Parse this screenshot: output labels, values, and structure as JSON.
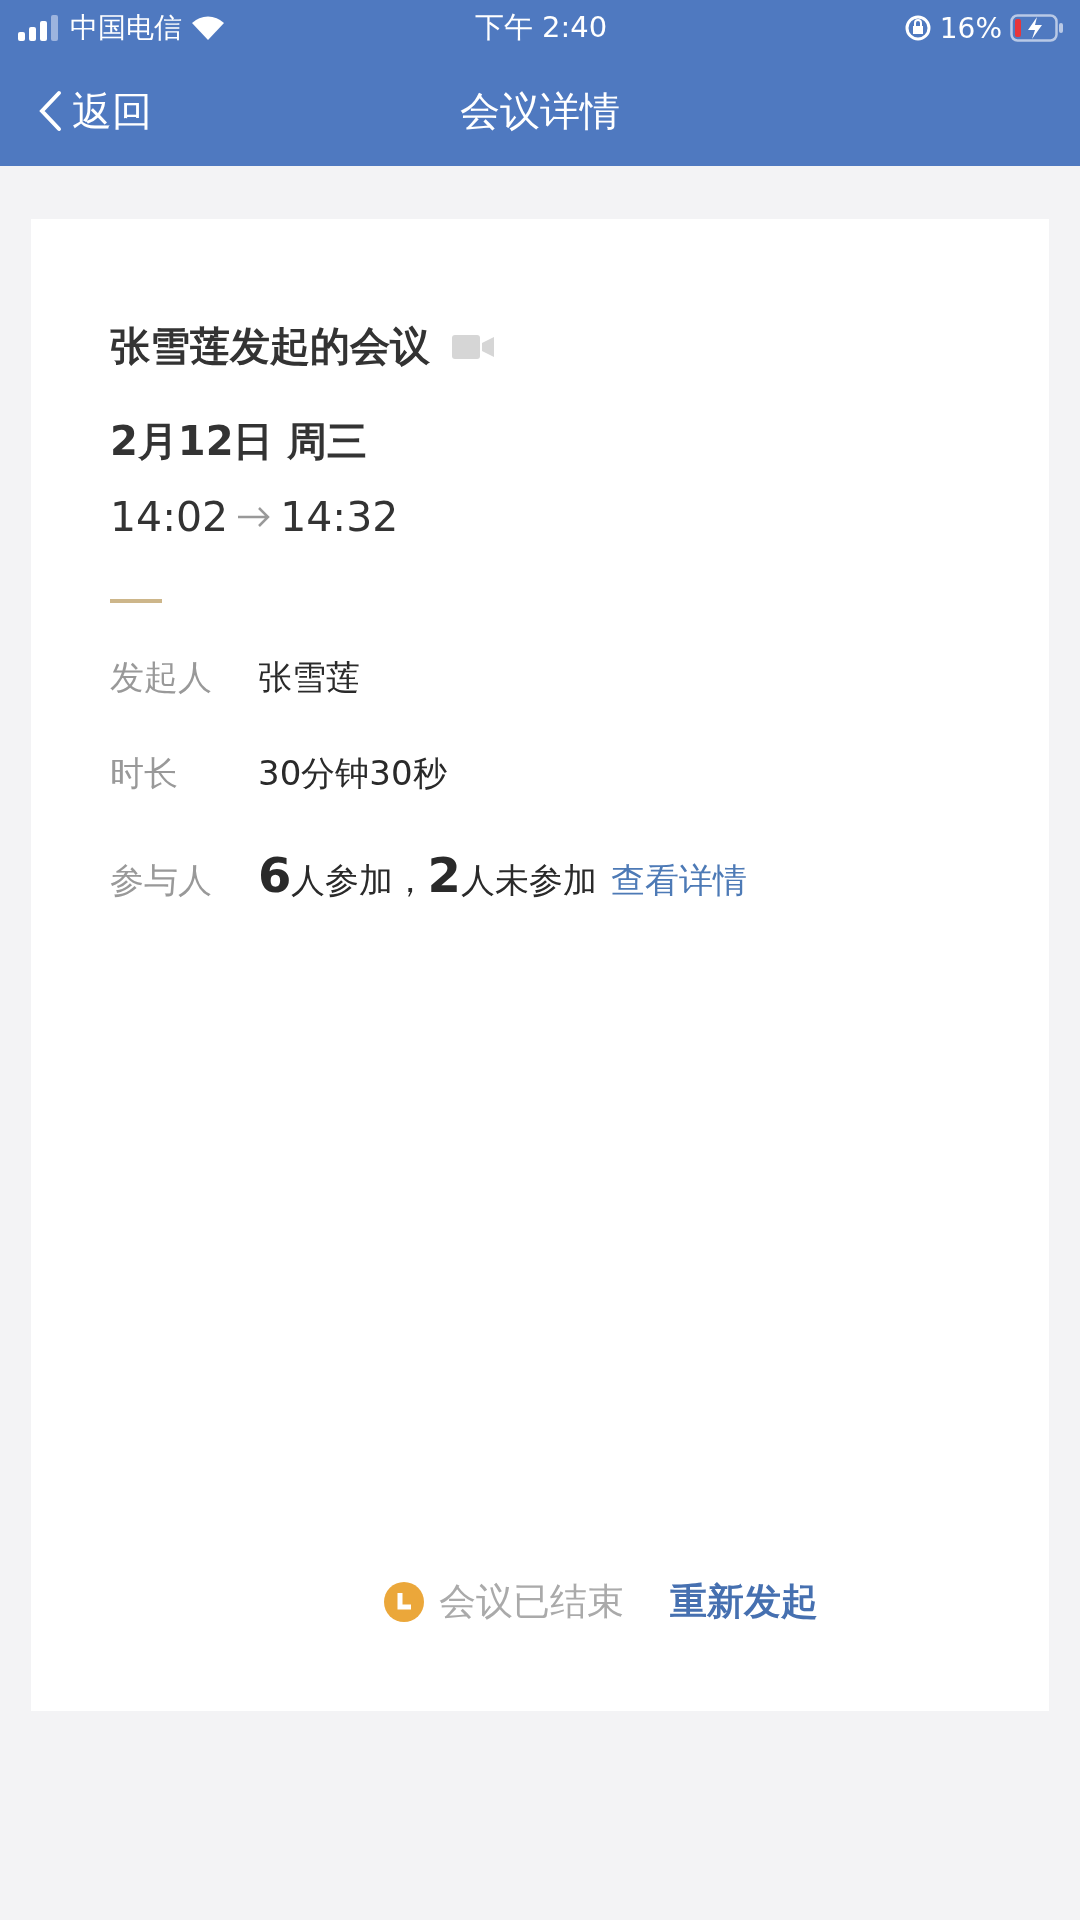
{
  "status_bar": {
    "carrier": "中国电信",
    "time": "下午 2:40",
    "battery": "16%"
  },
  "nav_bar": {
    "back": "返回",
    "title": "会议详情"
  },
  "meeting": {
    "title": "张雪莲发起的会议",
    "date": "2月12日 周三",
    "start": "14:02",
    "end": "14:32",
    "details": [
      {
        "label": "发起人",
        "value": "张雪莲"
      },
      {
        "label": "时长",
        "value": "30分钟30秒"
      },
      {
        "label": "参与人",
        "value": "**6**人参加，**2**人未参加",
        "link": "查看详情"
      }
    ],
    "status": "会议已结束",
    "action": "重新发起"
  }
}
